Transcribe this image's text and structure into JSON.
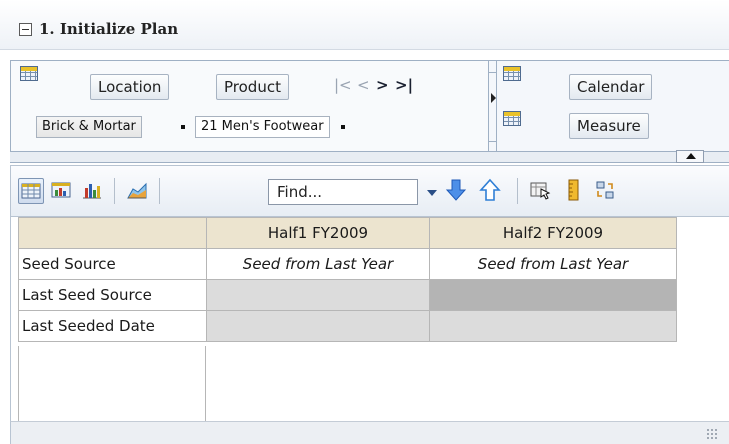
{
  "panel": {
    "title": "1. Initialize Plan"
  },
  "dimensions": {
    "row_dims": {
      "buttons": [
        "Location",
        "Product"
      ],
      "selected_values": [
        "Brick & Mortar",
        "21 Men's Footwear"
      ]
    },
    "col_dims": {
      "buttons": [
        "Calendar",
        "Measure"
      ]
    },
    "nav": [
      "|<",
      "<",
      ">",
      ">|"
    ]
  },
  "toolbar": {
    "find_placeholder": "Find...",
    "icons": [
      "table-view-icon",
      "chart-table-icon",
      "bar-chart-icon",
      "area-chart-icon",
      "dropdown-arrow-icon",
      "move-down-icon",
      "move-up-icon",
      "select-icon",
      "ruler-icon",
      "swap-icon"
    ]
  },
  "grid": {
    "columns": [
      "Half1 FY2009",
      "Half2 FY2009"
    ],
    "rows": [
      {
        "label": "Seed Source",
        "cells": [
          "Seed from Last Year",
          "Seed from Last Year"
        ]
      },
      {
        "label": "Last Seed Source",
        "cells": [
          "",
          ""
        ]
      },
      {
        "label": "Last Seeded Date",
        "cells": [
          "",
          ""
        ]
      }
    ]
  },
  "colors": {
    "header_bg": "#ece4cf",
    "accent_blue": "#2f6fd6",
    "cell_light": "#dcdcdc",
    "cell_dark": "#b4b4b4"
  }
}
